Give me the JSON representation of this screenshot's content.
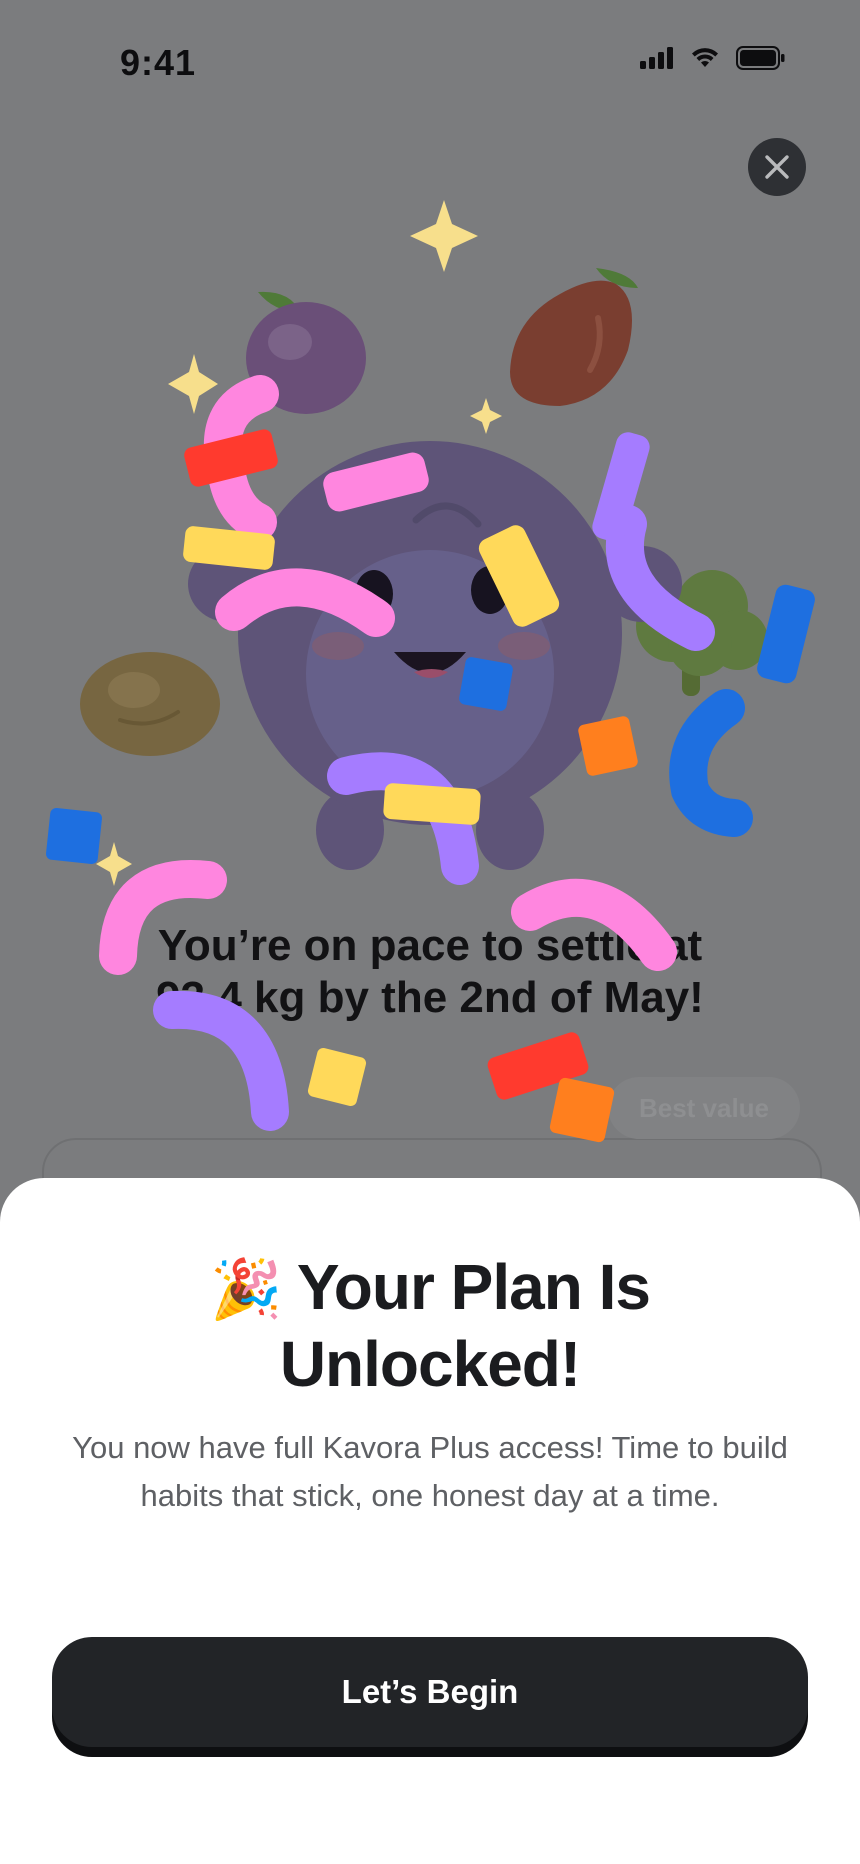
{
  "status_bar": {
    "time": "9:41"
  },
  "paywall": {
    "headline_line1": "You’re on pace to settle at",
    "headline_line2": "93.4 kg by the 2nd of May!",
    "badge": "Best value"
  },
  "sheet": {
    "emoji": "🎉",
    "title": "Your Plan Is Unlocked!",
    "body": "You now have full Kavora Plus access! Time to build habits that stick, one honest day at a time.",
    "cta": "Let’s Begin"
  },
  "colors": {
    "overlay": "#7b7c7e",
    "mascot": "#5e5478",
    "pink": "#ff86df",
    "purple": "#a57cff",
    "yellow": "#ffd95a",
    "blue": "#1e6fe0",
    "orange": "#ff7f1e",
    "red": "#ff3a2e",
    "button": "#222427"
  },
  "icons": [
    "signal-icon",
    "wifi-icon",
    "battery-icon",
    "close-icon",
    "party-popper-icon"
  ]
}
